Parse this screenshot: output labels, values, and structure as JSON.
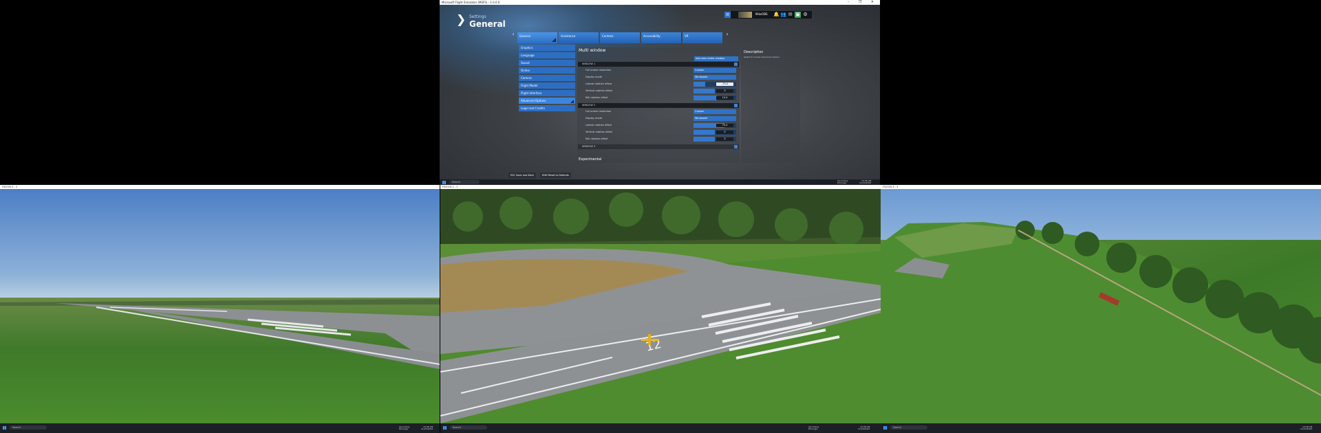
{
  "game_window": {
    "title": "Microsoft Flight Simulator (MSFS) - 1.0.0.0",
    "window_controls": [
      "–",
      "❐",
      "✕"
    ],
    "header": {
      "small": "Settings",
      "big": "General"
    },
    "topbar": {
      "username": "MikeOBS"
    },
    "tabs": [
      {
        "label": "General",
        "active": true
      },
      {
        "label": "Assistance",
        "active": false
      },
      {
        "label": "Controls",
        "active": false
      },
      {
        "label": "Accessibility",
        "active": false
      },
      {
        "label": "VR",
        "active": false
      }
    ],
    "sidebar": [
      {
        "label": "Graphics"
      },
      {
        "label": "Language"
      },
      {
        "label": "Sound"
      },
      {
        "label": "Online"
      },
      {
        "label": "Camera"
      },
      {
        "label": "Flight Model"
      },
      {
        "label": "Flight Interface"
      },
      {
        "label": "Advanced Options",
        "active": true
      },
      {
        "label": "Legal and Credits"
      }
    ],
    "panel": {
      "title": "Multi window",
      "add_button": "Add new render window",
      "window1": {
        "header": "WINDOW 1",
        "rows": [
          {
            "label": "Full screen resolution",
            "value": "Custom"
          },
          {
            "label": "Display mode",
            "value": "Windowed"
          },
          {
            "label": "Lateral rotation offset",
            "value": "-75.4",
            "fill": 0.28
          },
          {
            "label": "Vertical rotation offset",
            "value": "0",
            "fill": 0.5
          },
          {
            "label": "Roll rotation offset",
            "value": "14.4",
            "fill": 0.55
          }
        ]
      },
      "window2": {
        "header": "WINDOW 2",
        "rows": [
          {
            "label": "Full screen resolution",
            "value": "Custom"
          },
          {
            "label": "Display mode",
            "value": "Windowed"
          },
          {
            "label": "Lateral rotation offset",
            "value": "75.4",
            "fill": 0.72
          },
          {
            "label": "Vertical rotation offset",
            "value": "0",
            "fill": 0.5
          },
          {
            "label": "Roll rotation offset",
            "value": "0",
            "fill": 0.5
          }
        ]
      },
      "window3": {
        "header": "WINDOW 3"
      },
      "experimental": "Experimental"
    },
    "description": {
      "title": "Description",
      "text": "Select to access advanced options."
    },
    "footer": [
      {
        "key": "ESC",
        "label": "ESC Save and Back"
      },
      {
        "key": "END",
        "label": "END Reset to Defaults"
      }
    ]
  },
  "taskbar": {
    "search_placeholder": "Search",
    "weather_line1": "Upcoming",
    "weather_line2": "Earnings",
    "time": "10:38 AM",
    "date": "11/23/2023"
  },
  "views": [
    {
      "title": "FS2020-2 - 2"
    },
    {
      "title": "FS2020-1 - 1"
    },
    {
      "title": "FS2020-3 - 3"
    }
  ],
  "colors": {
    "accent": "#2f73c7",
    "panel": "#3c4046",
    "taskbar": "#1c1f26"
  }
}
